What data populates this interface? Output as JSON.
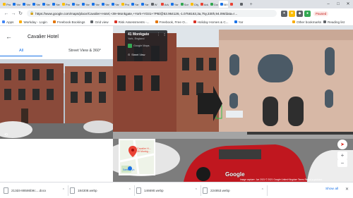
{
  "browser": {
    "tabs": [
      {
        "label": "Proj",
        "color": "#fbbc04"
      },
      {
        "label": "Yar",
        "color": "#1a73e8"
      },
      {
        "label": "Yar",
        "color": "#1a73e8"
      },
      {
        "label": "Yar",
        "color": "#1a73e8"
      },
      {
        "label": "Yar",
        "color": "#1a73e8"
      },
      {
        "label": "Yar",
        "color": "#1a73e8"
      },
      {
        "label": "Proj",
        "color": "#fbbc04"
      },
      {
        "label": "Yar",
        "color": "#1a73e8"
      },
      {
        "label": "Yar",
        "color": "#1a73e8"
      },
      {
        "label": "Yar",
        "color": "#1a73e8"
      },
      {
        "label": "Yar",
        "color": "#1a73e8"
      },
      {
        "label": "Yar",
        "color": "#1a73e8"
      },
      {
        "label": "Proj",
        "color": "#fbbc04"
      },
      {
        "label": "Yar",
        "color": "#1a73e8"
      },
      {
        "label": "Yar",
        "color": "#1a73e8"
      },
      {
        "label": "W",
        "color": "#5f6368"
      },
      {
        "label": "Adv",
        "color": "#ea4335"
      },
      {
        "label": "Yar",
        "color": "#1a73e8"
      },
      {
        "label": "Sort",
        "color": "#34a853"
      },
      {
        "label": "City",
        "color": "#fbbc04"
      },
      {
        "label": "Adv",
        "color": "#ea4335"
      },
      {
        "label": "Goo",
        "color": "#34a853"
      },
      {
        "label": "58 l",
        "color": "#1a73e8"
      },
      {
        "label": "",
        "color": "#ea4335"
      },
      {
        "label": "",
        "color": "#5f6368"
      }
    ],
    "new_tab": "+",
    "window_controls": {
      "minimize": "–",
      "maximize": "□",
      "close": "✕"
    },
    "url": "https://www.google.com/maps/place/Cavalier+Hotel,+39+Monkgate,+York+YO31+7PB/@53.964126,-1.0758163,3a,75y,330h,94.09t/data=!...",
    "pause_label": "Paused",
    "extensions": [
      {
        "icon": "extension-icon",
        "color": "#5f6368",
        "glyph": "✦"
      },
      {
        "icon": "star-icon",
        "color": "#fbbc04",
        "glyph": "★"
      },
      {
        "icon": "puzzle-icon",
        "color": "#5f6368",
        "glyph": "◆"
      },
      {
        "icon": "avatar-icon",
        "color": "#34a853",
        "glyph": "●"
      }
    ]
  },
  "bookmarks": [
    {
      "label": "Apps",
      "color": "#4285f4"
    },
    {
      "label": "Workday - Login",
      "color": "#f9ab00"
    },
    {
      "label": "Freebook Bookings",
      "color": "#e37400"
    },
    {
      "label": "Grid view",
      "color": "#5f6368"
    },
    {
      "label": "Risk Assessments -...",
      "color": "#d93025"
    },
    {
      "label": "Freebook, Free O...",
      "color": "#e37400"
    },
    {
      "label": "Holiday Homes & C...",
      "color": "#d93025"
    },
    {
      "label": "Yar",
      "color": "#1a73e8"
    }
  ],
  "bookmarks_right": [
    {
      "label": "Other bookmarks",
      "color": "#f9ab00"
    },
    {
      "label": "Reading list",
      "color": "#5f6368"
    }
  ],
  "panel": {
    "title": "Cavalier Hotel",
    "tabs": [
      "All",
      "Street View & 360°"
    ]
  },
  "streetview": {
    "address": "41 Monkgate",
    "city": "York, England",
    "maps_label": "Google Maps",
    "sv_label": "Street View",
    "minimap_label": "Cavalier H... 39 Monkg...",
    "minimap_sublabel": "Sainsbury's",
    "logo": "Google",
    "footer": "Image capture: Jun 2021   © 2021 Google   United Kingdom   Terms   Report a problem"
  },
  "downloads": {
    "items": [
      "213d4-88586b9c....docx",
      "184308.webp",
      "146690.webp",
      "224853.webp"
    ],
    "show_all": "Show all",
    "close": "✕"
  }
}
